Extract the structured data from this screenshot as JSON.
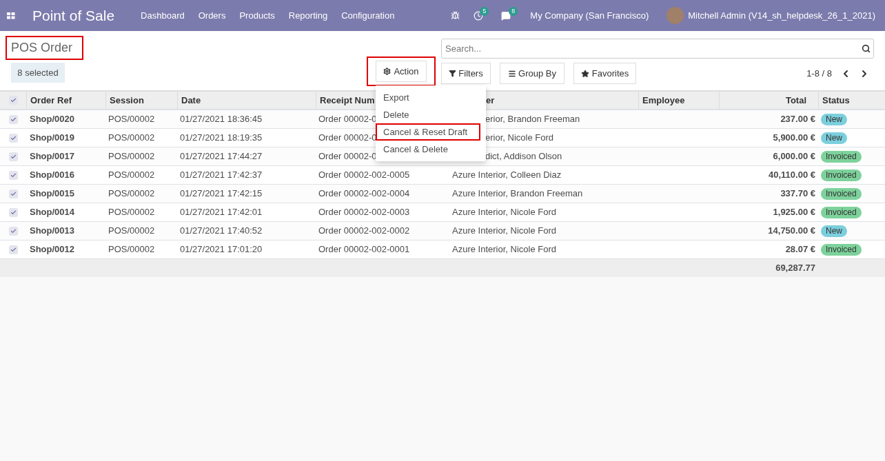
{
  "navbar": {
    "app_title": "Point of Sale",
    "menu": [
      "Dashboard",
      "Orders",
      "Products",
      "Reporting",
      "Configuration"
    ],
    "activity_count": "5",
    "message_count": "8",
    "company": "My Company (San Francisco)",
    "user": "Mitchell Admin (V14_sh_helpdesk_26_1_2021)"
  },
  "breadcrumb": "POS Order",
  "selection": "8 selected",
  "search": {
    "placeholder": "Search..."
  },
  "buttons": {
    "action": "Action",
    "filters": "Filters",
    "group_by": "Group By",
    "favorites": "Favorites"
  },
  "pager": "1-8 / 8",
  "action_menu": [
    {
      "label": "Export",
      "highlighted": false
    },
    {
      "label": "Delete",
      "highlighted": false
    },
    {
      "label": "Cancel & Reset Draft",
      "highlighted": true
    },
    {
      "label": "Cancel & Delete",
      "highlighted": false
    }
  ],
  "table": {
    "all_checked": true,
    "columns": [
      "Order Ref",
      "Session",
      "Date",
      "Receipt Num",
      "er",
      "Employee",
      "Total",
      "Status"
    ],
    "rows": [
      {
        "checked": true,
        "order_ref": "Shop/0020",
        "session": "POS/00002",
        "date": "01/27/2021 18:36:45",
        "receipt": "Order 00002-0",
        "customer": "erior, Brandon Freeman",
        "total": "237.00 €",
        "status": {
          "label": "New",
          "kind": "new"
        }
      },
      {
        "checked": true,
        "order_ref": "Shop/0019",
        "session": "POS/00002",
        "date": "01/27/2021 18:19:35",
        "receipt": "Order 00002-0",
        "customer": "erior, Nicole Ford",
        "total": "5,900.00 €",
        "status": {
          "label": "New",
          "kind": "new"
        }
      },
      {
        "checked": true,
        "order_ref": "Shop/0017",
        "session": "POS/00002",
        "date": "01/27/2021 17:44:27",
        "receipt": "Order 00002-0",
        "customer": "dict, Addison Olson",
        "total": "6,000.00 €",
        "status": {
          "label": "Invoiced",
          "kind": "invoiced"
        }
      },
      {
        "checked": true,
        "order_ref": "Shop/0016",
        "session": "POS/00002",
        "date": "01/27/2021 17:42:37",
        "receipt": "Order 00002-002-0005",
        "customer": "Azure Interior, Colleen Diaz",
        "total": "40,110.00 €",
        "status": {
          "label": "Invoiced",
          "kind": "invoiced"
        }
      },
      {
        "checked": true,
        "order_ref": "Shop/0015",
        "session": "POS/00002",
        "date": "01/27/2021 17:42:15",
        "receipt": "Order 00002-002-0004",
        "customer": "Azure Interior, Brandon Freeman",
        "total": "337.70 €",
        "status": {
          "label": "Invoiced",
          "kind": "invoiced"
        }
      },
      {
        "checked": true,
        "order_ref": "Shop/0014",
        "session": "POS/00002",
        "date": "01/27/2021 17:42:01",
        "receipt": "Order 00002-002-0003",
        "customer": "Azure Interior, Nicole Ford",
        "total": "1,925.00 €",
        "status": {
          "label": "Invoiced",
          "kind": "invoiced"
        }
      },
      {
        "checked": true,
        "order_ref": "Shop/0013",
        "session": "POS/00002",
        "date": "01/27/2021 17:40:52",
        "receipt": "Order 00002-002-0002",
        "customer": "Azure Interior, Nicole Ford",
        "total": "14,750.00 €",
        "status": {
          "label": "New",
          "kind": "new"
        }
      },
      {
        "checked": true,
        "order_ref": "Shop/0012",
        "session": "POS/00002",
        "date": "01/27/2021 17:01:20",
        "receipt": "Order 00002-002-0001",
        "customer": "Azure Interior, Nicole Ford",
        "total": "28.07 €",
        "status": {
          "label": "Invoiced",
          "kind": "invoiced"
        }
      }
    ],
    "sum_total": "69,287.77"
  }
}
